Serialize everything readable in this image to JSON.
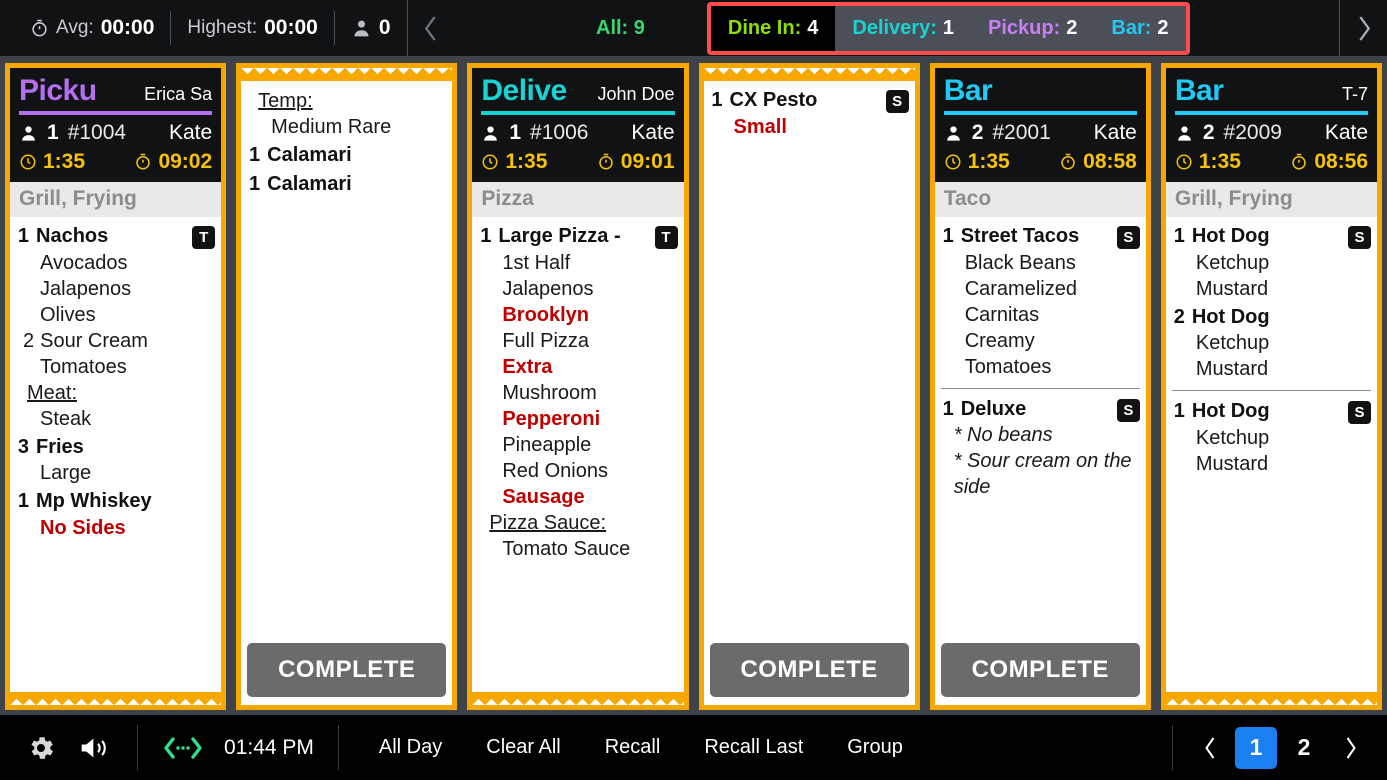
{
  "topbar": {
    "avg_label": "Avg:",
    "avg_value": "00:00",
    "highest_label": "Highest:",
    "highest_value": "00:00",
    "people_count": "0",
    "prev_icon": "chevron-left-icon",
    "next_icon": "chevron-right-icon",
    "all_label": "All:",
    "all_count": "9",
    "highlight_color": "#ff4d4d",
    "filters": [
      {
        "label": "Dine In:",
        "count": "4",
        "color": "#8ee000",
        "active": true
      },
      {
        "label": "Delivery:",
        "count": "1",
        "color": "#17d4d4",
        "active": false
      },
      {
        "label": "Pickup:",
        "count": "2",
        "color": "#c87ef5",
        "active": false
      },
      {
        "label": "Bar:",
        "count": "2",
        "color": "#21c9f5",
        "active": false
      }
    ]
  },
  "tickets": [
    {
      "id": "ticket-1004",
      "has_header": true,
      "type": "Picku",
      "type_color": "#b46ff0",
      "guest": "Erica Sa",
      "cover": "1",
      "order_number": "#1004",
      "server": "Kate",
      "timer_clock": "1:35",
      "timer_elapsed": "09:02",
      "station": "Grill, Frying",
      "saw_top": false,
      "saw_bottom": true,
      "complete_label": null,
      "items": [
        {
          "qty": "1",
          "name": "Nachos",
          "badge": "T",
          "divided": false,
          "mods": [
            {
              "text": "Avocados",
              "style": "plain"
            },
            {
              "text": "Jalapenos",
              "style": "plain"
            },
            {
              "text": "Olives",
              "style": "plain"
            },
            {
              "qty": "2",
              "text": "Sour Cream",
              "style": "plain"
            },
            {
              "text": "Tomatoes",
              "style": "plain"
            },
            {
              "text": "Meat:",
              "style": "group"
            },
            {
              "text": "Steak",
              "style": "plain"
            }
          ]
        },
        {
          "qty": "3",
          "name": "Fries",
          "badge": null,
          "divided": false,
          "mods": [
            {
              "text": "Large",
              "style": "plain"
            }
          ]
        },
        {
          "qty": "1",
          "name": "Mp Whiskey",
          "badge": null,
          "divided": false,
          "mods": [
            {
              "text": "No Sides",
              "style": "red"
            }
          ]
        }
      ]
    },
    {
      "id": "ticket-1004-cont",
      "has_header": false,
      "type": null,
      "type_color": null,
      "guest": null,
      "cover": null,
      "order_number": null,
      "server": null,
      "timer_clock": null,
      "timer_elapsed": null,
      "station": null,
      "saw_top": true,
      "saw_bottom": false,
      "complete_label": "COMPLETE",
      "items": [
        {
          "qty": null,
          "name": null,
          "badge": null,
          "divided": false,
          "mods": [
            {
              "text": "Temp:",
              "style": "group"
            },
            {
              "text": "Medium Rare",
              "style": "plain"
            }
          ]
        },
        {
          "qty": "1",
          "name": "Calamari",
          "badge": null,
          "divided": false,
          "mods": []
        },
        {
          "qty": "1",
          "name": "Calamari",
          "badge": null,
          "divided": false,
          "mods": []
        }
      ]
    },
    {
      "id": "ticket-1006",
      "has_header": true,
      "type": "Delive",
      "type_color": "#17d4d4",
      "guest": "John Doe",
      "cover": "1",
      "order_number": "#1006",
      "server": "Kate",
      "timer_clock": "1:35",
      "timer_elapsed": "09:01",
      "station": "Pizza",
      "saw_top": false,
      "saw_bottom": true,
      "complete_label": null,
      "items": [
        {
          "qty": "1",
          "name": "Large Pizza -",
          "badge": "T",
          "divided": false,
          "mods": [
            {
              "text": "1st Half",
              "style": "plain"
            },
            {
              "text": "Jalapenos",
              "style": "plain"
            },
            {
              "text": "Brooklyn",
              "style": "red"
            },
            {
              "text": "Full Pizza",
              "style": "plain"
            },
            {
              "text": "Extra",
              "style": "red"
            },
            {
              "text": "Mushroom",
              "style": "plain"
            },
            {
              "text": "Pepperoni",
              "style": "red"
            },
            {
              "text": "Pineapple",
              "style": "plain"
            },
            {
              "text": "Red Onions",
              "style": "plain"
            },
            {
              "text": "Sausage",
              "style": "red"
            },
            {
              "text": "Pizza Sauce:",
              "style": "group"
            },
            {
              "text": "Tomato Sauce",
              "style": "plain"
            }
          ]
        }
      ]
    },
    {
      "id": "ticket-cx-pesto",
      "has_header": false,
      "type": null,
      "type_color": null,
      "guest": null,
      "cover": null,
      "order_number": null,
      "server": null,
      "timer_clock": null,
      "timer_elapsed": null,
      "station": null,
      "saw_top": true,
      "saw_bottom": false,
      "complete_label": "COMPLETE",
      "items": [
        {
          "qty": "1",
          "name": "CX Pesto",
          "badge": "S",
          "divided": false,
          "mods": [
            {
              "text": "Small",
              "style": "red"
            }
          ]
        }
      ]
    },
    {
      "id": "ticket-2001",
      "has_header": true,
      "type": "Bar",
      "type_color": "#21c9f5",
      "guest": "",
      "cover": "2",
      "order_number": "#2001",
      "server": "Kate",
      "timer_clock": "1:35",
      "timer_elapsed": "08:58",
      "station": "Taco",
      "saw_top": false,
      "saw_bottom": false,
      "complete_label": "COMPLETE",
      "items": [
        {
          "qty": "1",
          "name": "Street Tacos",
          "badge": "S",
          "divided": false,
          "mods": [
            {
              "text": "Black Beans",
              "style": "plain"
            },
            {
              "text": "Caramelized",
              "style": "plain"
            },
            {
              "text": "Carnitas",
              "style": "plain"
            },
            {
              "text": "Creamy",
              "style": "plain"
            },
            {
              "text": "Tomatoes",
              "style": "plain"
            }
          ]
        },
        {
          "qty": "1",
          "name": "Deluxe",
          "badge": "S",
          "divided": true,
          "mods": [
            {
              "text": "* No beans",
              "style": "note"
            },
            {
              "text": "* Sour cream on the side",
              "style": "note"
            }
          ]
        }
      ]
    },
    {
      "id": "ticket-2009",
      "has_header": true,
      "type": "Bar",
      "type_color": "#21c9f5",
      "guest": "T-7",
      "cover": "2",
      "order_number": "#2009",
      "server": "Kate",
      "timer_clock": "1:35",
      "timer_elapsed": "08:56",
      "station": "Grill, Frying",
      "saw_top": false,
      "saw_bottom": true,
      "complete_label": null,
      "items": [
        {
          "qty": "1",
          "name": "Hot Dog",
          "badge": "S",
          "divided": false,
          "mods": [
            {
              "text": "Ketchup",
              "style": "plain"
            },
            {
              "text": "Mustard",
              "style": "plain"
            }
          ]
        },
        {
          "qty": "2",
          "name": "Hot Dog",
          "badge": null,
          "divided": false,
          "mods": [
            {
              "text": "Ketchup",
              "style": "plain"
            },
            {
              "text": "Mustard",
              "style": "plain"
            }
          ]
        },
        {
          "qty": "1",
          "name": "Hot Dog",
          "badge": "S",
          "divided": true,
          "mods": [
            {
              "text": "Ketchup",
              "style": "plain"
            },
            {
              "text": "Mustard",
              "style": "plain"
            }
          ]
        }
      ]
    }
  ],
  "bottombar": {
    "settings_icon": "gear-icon",
    "sound_icon": "speaker-icon",
    "expand_icon": "expand-collapse-icon",
    "time": "01:44 PM",
    "actions": [
      "All Day",
      "Clear All",
      "Recall",
      "Recall Last",
      "Group"
    ],
    "pager": {
      "prev_icon": "chevron-left-icon",
      "next_icon": "chevron-right-icon",
      "pages": [
        "1",
        "2"
      ],
      "active_page": "1",
      "active_color": "#1a7ff0"
    }
  }
}
